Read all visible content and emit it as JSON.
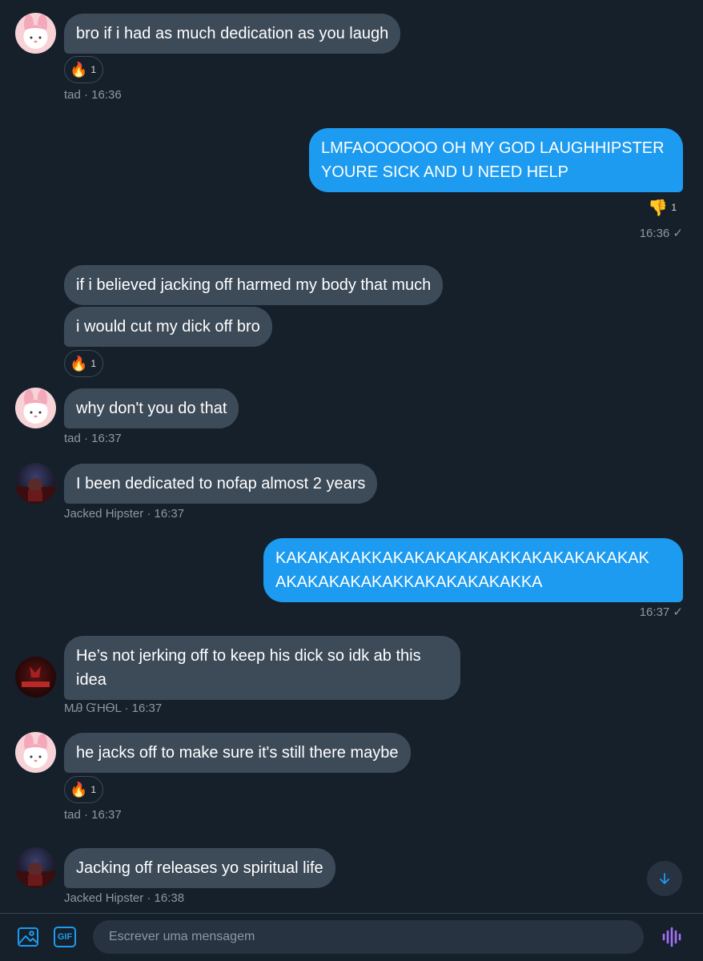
{
  "messages": [
    {
      "text": "bro if i had as much dedication as you laugh",
      "meta": "tad · 16:36",
      "reaction": {
        "emoji": "🔥",
        "count": "1"
      }
    },
    {
      "text": "LMFAOOOOOO OH MY GOD LAUGHHIPSTER YOURE SICK AND U NEED HELP",
      "meta": "16:36 ✓",
      "reaction": {
        "emoji": "👎",
        "count": "1"
      }
    },
    {
      "text": "if i believed jacking off harmed my body that much"
    },
    {
      "text": "i would cut my dick off bro",
      "reaction": {
        "emoji": "🔥",
        "count": "1"
      }
    },
    {
      "text": "why don't you do that",
      "meta": "tad · 16:37"
    },
    {
      "text": "I been dedicated to nofap almost 2 years",
      "meta": "Jacked Hipster · 16:37"
    },
    {
      "text": "KAKAKAKAKKAKAKAKAKAKAKKAKAKAKAKAKAK AKAKAKAKAKAKKAKAKAKAKAKKA",
      "meta": "16:37 ✓"
    },
    {
      "text": "He’s not jerking off to keep his dick so idk ab this idea",
      "meta": "MᎯ ᏳHᎾL · 16:37"
    },
    {
      "text": "he jacks off to make sure it's still there maybe",
      "meta": "tad · 16:37",
      "reaction": {
        "emoji": "🔥",
        "count": "1"
      }
    },
    {
      "text": "Jacking off releases yo spiritual life",
      "meta": "Jacked Hipster · 16:38"
    }
  ],
  "composer": {
    "placeholder": "Escrever uma mensagem"
  },
  "icons": {
    "image": "image-icon",
    "gif": "GIF",
    "voice": "voice-waveform-icon",
    "scroll": "arrow-down-icon"
  },
  "colors": {
    "background": "#15202b",
    "incoming_bubble": "#3d4a58",
    "outgoing_bubble": "#1d9bf0",
    "accent": "#1d9bf0",
    "voice": "#a371f7"
  }
}
